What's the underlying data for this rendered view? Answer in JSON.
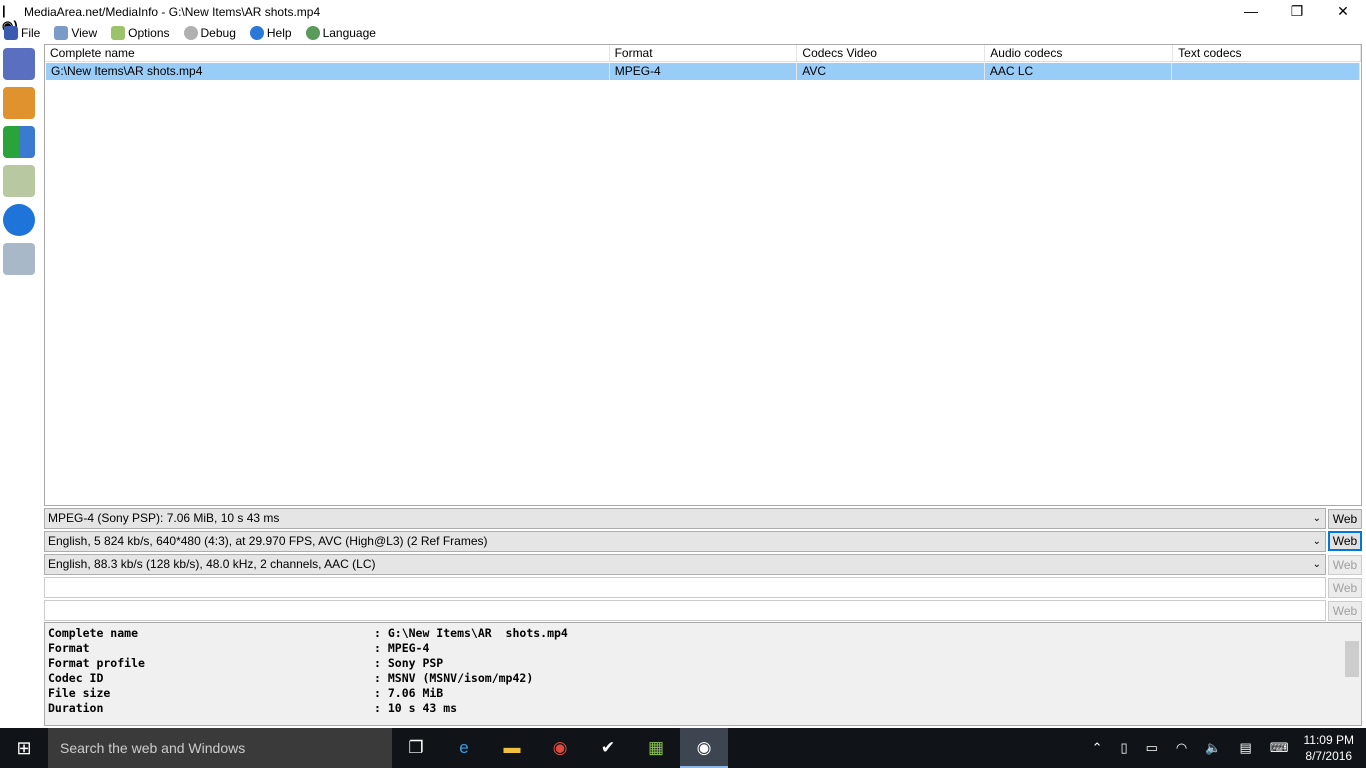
{
  "window": {
    "title": "MediaArea.net/MediaInfo - G:\\New Items\\AR  shots.mp4",
    "minimize": "—",
    "restore": "❐",
    "close": "✕"
  },
  "menu": [
    {
      "label": "File",
      "color": "#3a5bb0"
    },
    {
      "label": "View",
      "color": "#7a9ac8"
    },
    {
      "label": "Options",
      "color": "#9bc36b"
    },
    {
      "label": "Debug",
      "color": "#b0b0b0"
    },
    {
      "label": "Help",
      "color": "#2a78d8"
    },
    {
      "label": "Language",
      "color": "#5a9a5a"
    }
  ],
  "table": {
    "headers": [
      "Complete name",
      "Format",
      "Codecs Video",
      "Audio codecs",
      "Text codecs"
    ],
    "rows": [
      [
        "G:\\New Items\\AR  shots.mp4",
        "MPEG-4",
        "AVC",
        "AAC LC",
        ""
      ]
    ]
  },
  "streams": [
    "MPEG-4 (Sony PSP): 7.06 MiB, 10 s 43 ms",
    "English, 5 824 kb/s, 640*480 (4:3), at 29.970 FPS, AVC (High@L3) (2 Ref Frames)",
    "English, 88.3 kb/s (128 kb/s), 48.0 kHz, 2 channels, AAC (LC)"
  ],
  "web_label": "Web",
  "info": [
    [
      "Complete name",
      ": G:\\New Items\\AR  shots.mp4"
    ],
    [
      "Format",
      ": MPEG-4"
    ],
    [
      "Format profile",
      ": Sony PSP"
    ],
    [
      "Codec ID",
      ": MSNV (MSNV/isom/mp42)"
    ],
    [
      "File size",
      ": 7.06 MiB"
    ],
    [
      "Duration",
      ": 10 s 43 ms"
    ]
  ],
  "taskbar": {
    "search_placeholder": "Search the web and Windows",
    "time": "11:09 PM",
    "date": "8/7/2016"
  }
}
